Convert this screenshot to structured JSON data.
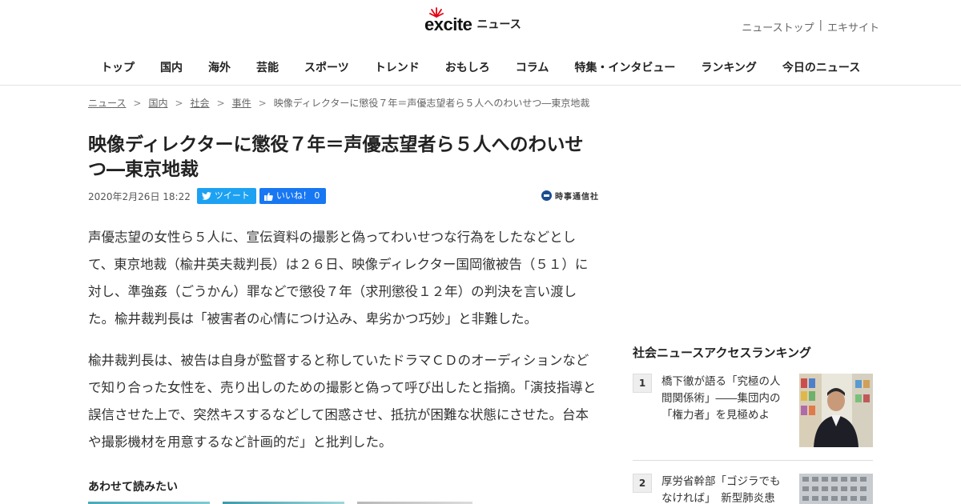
{
  "header": {
    "logo_text": "excite",
    "logo_sub": "ニュース",
    "top_links": [
      "ニューストップ",
      "エキサイト"
    ],
    "top_links_sep": "|",
    "nav": [
      "トップ",
      "国内",
      "海外",
      "芸能",
      "スポーツ",
      "トレンド",
      "おもしろ",
      "コラム",
      "特集・インタビュー",
      "ランキング",
      "今日のニュース"
    ]
  },
  "breadcrumb": [
    "ニュース",
    "国内",
    "社会",
    "事件",
    "映像ディレクターに懲役７年＝声優志望者ら５人へのわいせつ―東京地裁"
  ],
  "breadcrumb_sep": ">",
  "article": {
    "title": "映像ディレクターに懲役７年＝声優志望者ら５人へのわいせつ―東京地裁",
    "date": "2020年2月26日 18:22",
    "tweet_label": "ツイート",
    "like_label": "いいね！ 0",
    "source": "時事通信社",
    "paragraphs": [
      "声優志望の女性ら５人に、宣伝資料の撮影と偽ってわいせつな行為をしたなどとして、東京地裁（楡井英夫裁判長）は２６日、映像ディレクター国岡徹被告（５１）に対し、準強姦（ごうかん）罪などで懲役７年（求刑懲役１２年）の判決を言い渡した。楡井裁判長は「被害者の心情につけ込み、卑劣かつ巧妙」と非難した。",
      "楡井裁判長は、被告は自身が監督すると称していたドラマＣＤのオーディションなどで知り合った女性を、売り出しのための撮影と偽って呼び出したと指摘。「演技指導と誤信させた上で、突然キスするなどして困惑させ、抵抗が困難な状態にさせた。台本や撮影機材を用意するなど計画的だ」と批判した。"
    ],
    "related_heading": "あわせて読みたい"
  },
  "sidebar": {
    "ranking_heading": "社会ニュースアクセスランキング",
    "ranking": [
      {
        "rank": "1",
        "title": "橋下徹が語る「究極の人間関係術」――集団内の「権力者」を見極めよ"
      },
      {
        "rank": "2",
        "title": "厚労省幹部「ゴジラでもなければ」　新型肺炎患"
      }
    ]
  },
  "colors": {
    "tweet": "#1da1f2",
    "like": "#1877f2",
    "logo_accent": "#e60012"
  }
}
